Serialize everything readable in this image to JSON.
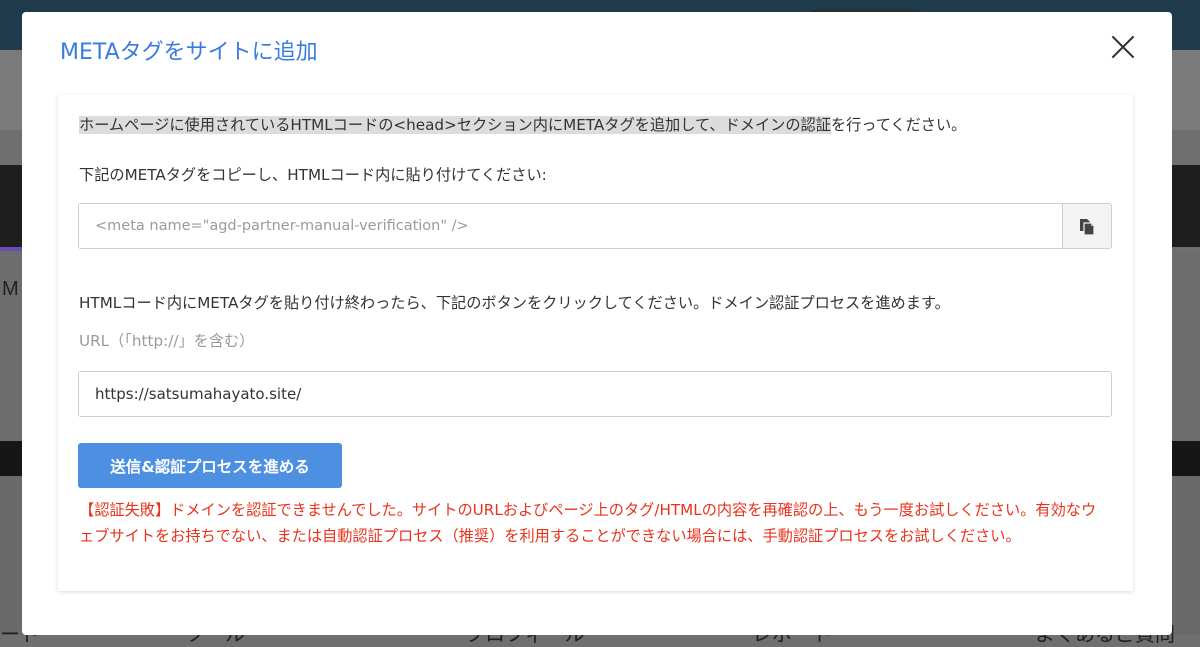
{
  "modal": {
    "title": "METAタグをサイトに追加",
    "instruction_highlight": "ホームページに使用されているHTMLコードの<head>セクション内にMETAタグを追加して、ドメインの認証",
    "instruction_rest": "を行ってください。",
    "copy_instruction": "下記のMETAタグをコピーし、HTMLコード内に貼り付けてください:",
    "meta_tag_value": "<meta name=\"agd-partner-manual-verification\" />",
    "after_paste_instruction": "HTMLコード内にMETAタグを貼り付け終わったら、下記のボタンをクリックしてください。ドメイン認証プロセスを進めます。",
    "url_label": "URL（「http://」を含む）",
    "url_value": "https://satsumahayato.site/",
    "submit_label": "送信&認証プロセスを進める",
    "error_message": "【認証失敗】ドメインを認証できませんでした。サイトのURLおよびページ上のタグ/HTMLの内容を再確認の上、もう一度お試しください。有効なウェブサイトをお持ちでない、または自動認証プロセス（推奨）を利用することができない場合には、手動認証プロセスをお試しください。"
  },
  "background": {
    "left_letter": "M",
    "nav_items": [
      "ード",
      "ツール",
      "プロフィール",
      "レポート",
      "よくあるご質問"
    ]
  },
  "colors": {
    "title": "#3a7be0",
    "button": "#4d8fe0",
    "error": "#e8331c",
    "overlay": "#6f6f6f"
  },
  "icons": {
    "close": "close-icon",
    "copy": "copy-icon"
  }
}
